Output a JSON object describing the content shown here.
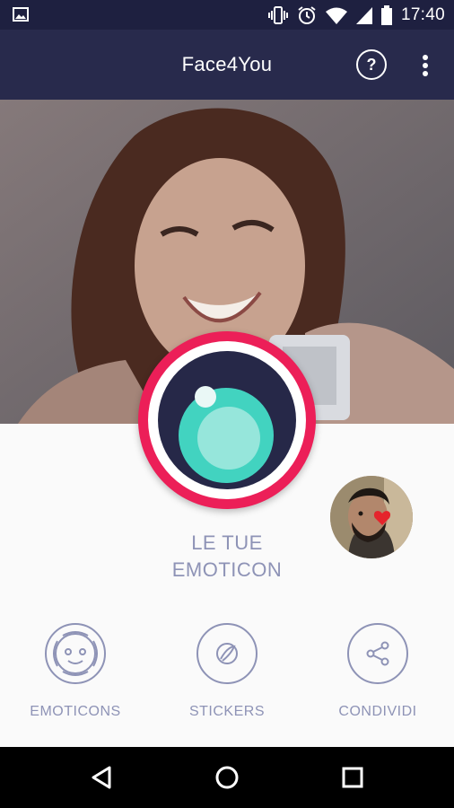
{
  "status_bar": {
    "time": "17:40",
    "icons": [
      "gallery-icon",
      "vibrate-icon",
      "alarm-icon",
      "wifi-icon",
      "signal-icon",
      "battery-icon"
    ]
  },
  "app_bar": {
    "title": "Face4You",
    "help_label": "?",
    "icons": [
      "help-icon",
      "overflow-menu-icon"
    ]
  },
  "capture": {
    "icon": "camera-lens-icon",
    "colors": {
      "ring": "#ec1f58",
      "body": "#262848",
      "lens": "#42d3c0"
    }
  },
  "emoticon_text": {
    "line1": "LE TUE",
    "line2": "EMOTICON"
  },
  "actions": [
    {
      "label": "EMOTICONS",
      "icon": "emoticon-face-icon"
    },
    {
      "label": "STICKERS",
      "icon": "sticker-icon"
    },
    {
      "label": "CONDIVIDI",
      "icon": "share-icon"
    }
  ],
  "nav_bar": {
    "icons": [
      "back-icon",
      "home-icon",
      "recents-icon"
    ]
  },
  "colors": {
    "app_bar": "#282a4c",
    "status_bar": "#1e2040",
    "accent_text": "#8e93b6",
    "capture_ring": "#ec1f58"
  }
}
